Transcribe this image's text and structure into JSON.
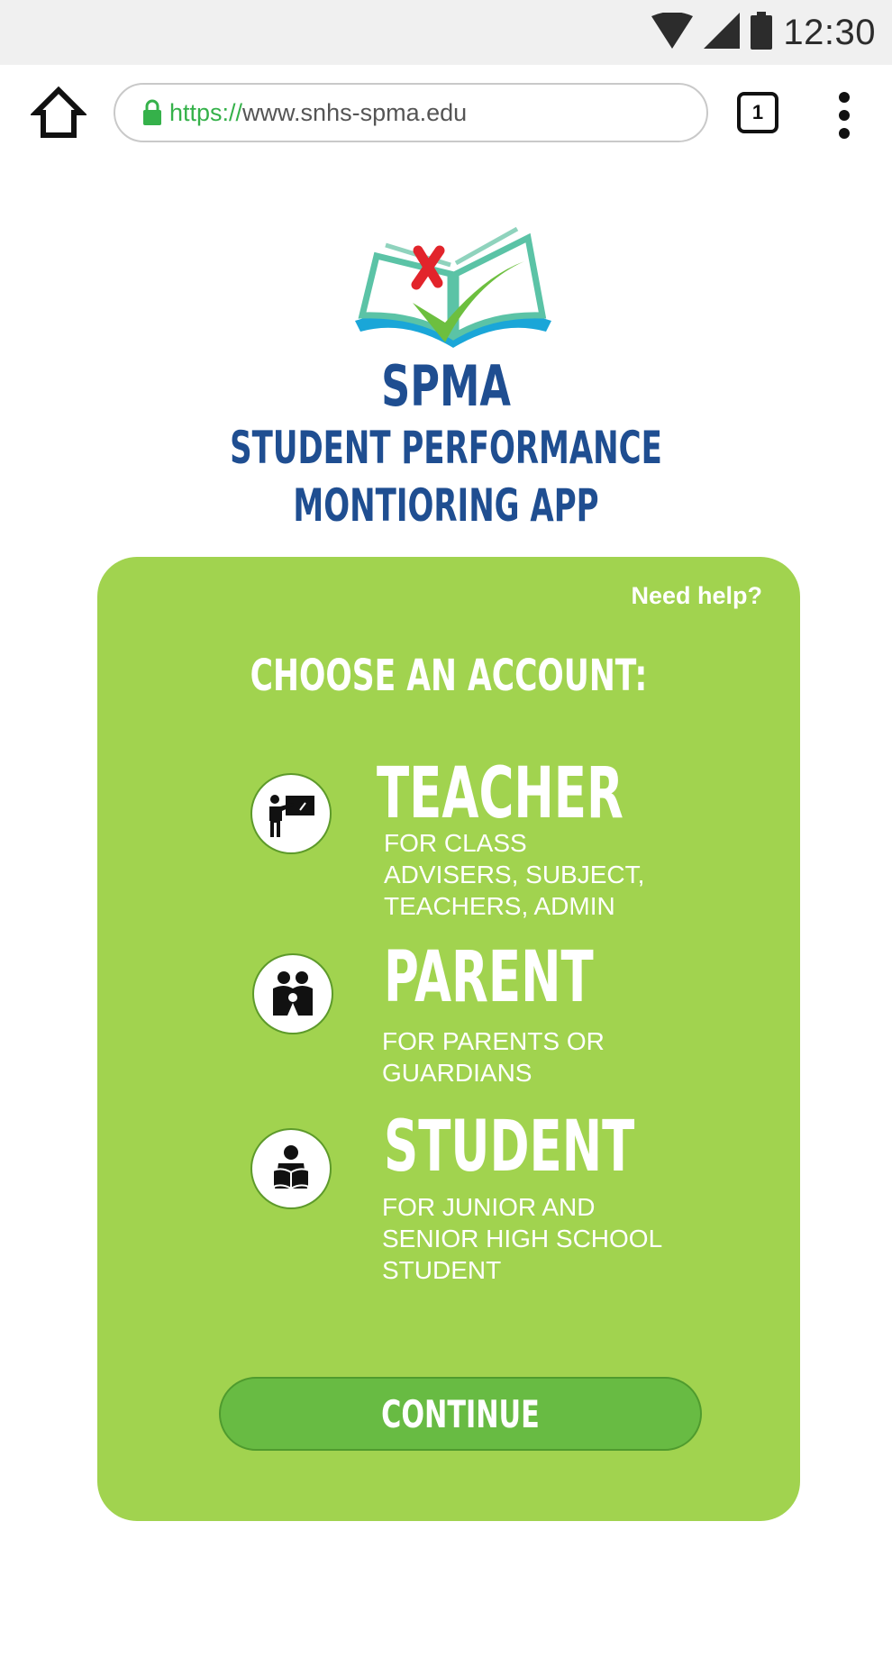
{
  "status_bar": {
    "time": "12:30"
  },
  "browser": {
    "url_scheme": "https://",
    "url_host": "www.snhs-spma.edu",
    "tab_count": "1"
  },
  "brand": {
    "short_name": "SPMA",
    "title_line1": "STUDENT PERFORMANCE",
    "title_line2": "MONTIORING APP"
  },
  "card": {
    "help_link": "Need help?",
    "heading": "CHOOSE AN ACCOUNT:",
    "accounts": [
      {
        "title": "TEACHER",
        "description": "FOR CLASS\nADVISERS, SUBJECT,\nTEACHERS, ADMIN",
        "icon": "teacher-icon"
      },
      {
        "title": "PARENT",
        "description": "FOR PARENTS OR\nGUARDIANS",
        "icon": "parent-icon"
      },
      {
        "title": "STUDENT",
        "description": "FOR JUNIOR AND\nSENIOR HIGH SCHOOL\nSTUDENT",
        "icon": "student-icon"
      }
    ],
    "continue_label": "CONTINUE"
  },
  "colors": {
    "card_green": "#a1d34f",
    "button_green": "#68bb43",
    "brand_blue": "#1f4e91",
    "url_green": "#35b14a"
  }
}
